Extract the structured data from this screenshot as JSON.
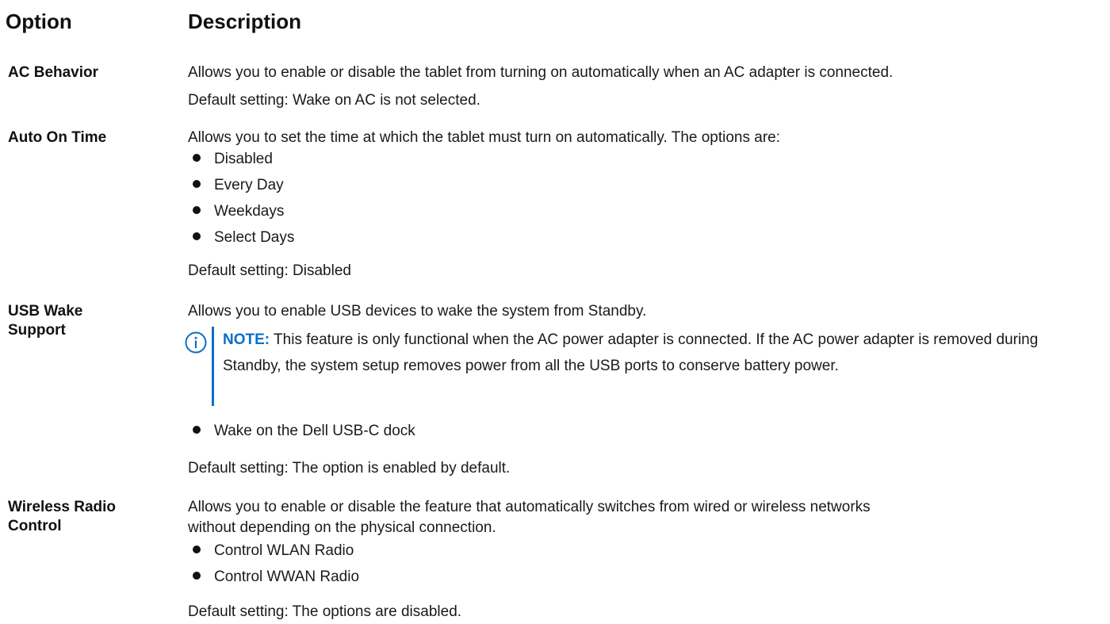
{
  "table_header": {
    "option": "Option",
    "description": "Description"
  },
  "rows": [
    {
      "option": "AC Behavior",
      "description": "Allows you to enable or disable the tablet from turning on automatically when an AC adapter is connected.",
      "default": "Default setting: Wake on AC is not selected."
    },
    {
      "option": "Auto On Time",
      "description": "Allows you to set the time at which the tablet must turn on automatically. The options are:",
      "bullets": [
        "Disabled",
        "Every Day",
        "Weekdays",
        "Select Days"
      ],
      "default": "Default setting: Disabled"
    },
    {
      "option_line1": "USB Wake",
      "option_line2": "Support",
      "description": "Allows you to enable USB devices to wake the system from Standby.",
      "note_label": "NOTE:",
      "note_text": "This feature is only functional when the AC power adapter is connected. If the AC power adapter is removed during Standby, the system setup removes power from all the USB ports to conserve battery power.",
      "bullets": [
        "Wake on the Dell USB-C dock"
      ],
      "default": "Default setting: The option is enabled by default."
    },
    {
      "option_line1": "Wireless Radio",
      "option_line2": "Control",
      "description_line1": "Allows you to enable or disable the feature that automatically switches from wired or wireless networks",
      "description_line2": "without depending on the physical connection.",
      "bullets": [
        "Control WLAN Radio",
        "Control WWAN Radio"
      ],
      "default": "Default setting: The options are disabled."
    }
  ],
  "icons": {
    "note": "info-circle-icon"
  },
  "colors": {
    "note_accent": "#0a6ec7"
  }
}
